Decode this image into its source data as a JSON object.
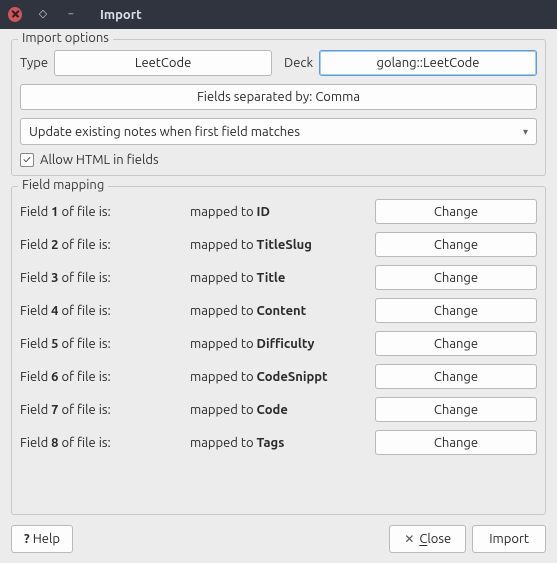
{
  "titlebar": {
    "title": "Import"
  },
  "importOptions": {
    "title": "Import options",
    "typeLabel": "Type",
    "typeValue": "LeetCode",
    "deckLabel": "Deck",
    "deckValue": "golang::LeetCode",
    "separator": "Fields separated by: Comma",
    "updateMode": "Update existing notes when first field matches",
    "allowHtml": "Allow HTML in fields",
    "allowHtmlChecked": true
  },
  "fieldMapping": {
    "title": "Field mapping",
    "changeLabel": "Change",
    "rows": [
      {
        "n": "1",
        "to": "ID"
      },
      {
        "n": "2",
        "to": "TitleSlug"
      },
      {
        "n": "3",
        "to": "Title"
      },
      {
        "n": "4",
        "to": "Content"
      },
      {
        "n": "5",
        "to": "Difficulty"
      },
      {
        "n": "6",
        "to": "CodeSnippt"
      },
      {
        "n": "7",
        "to": "Code"
      },
      {
        "n": "8",
        "to": "Tags"
      }
    ]
  },
  "bottom": {
    "help": "Help",
    "closeFirst": "C",
    "closeRest": "lose",
    "import": "Import"
  },
  "words": {
    "fieldPrefix": "Field ",
    "fieldSuffix": " of file is:",
    "mappedTo": "mapped to "
  }
}
